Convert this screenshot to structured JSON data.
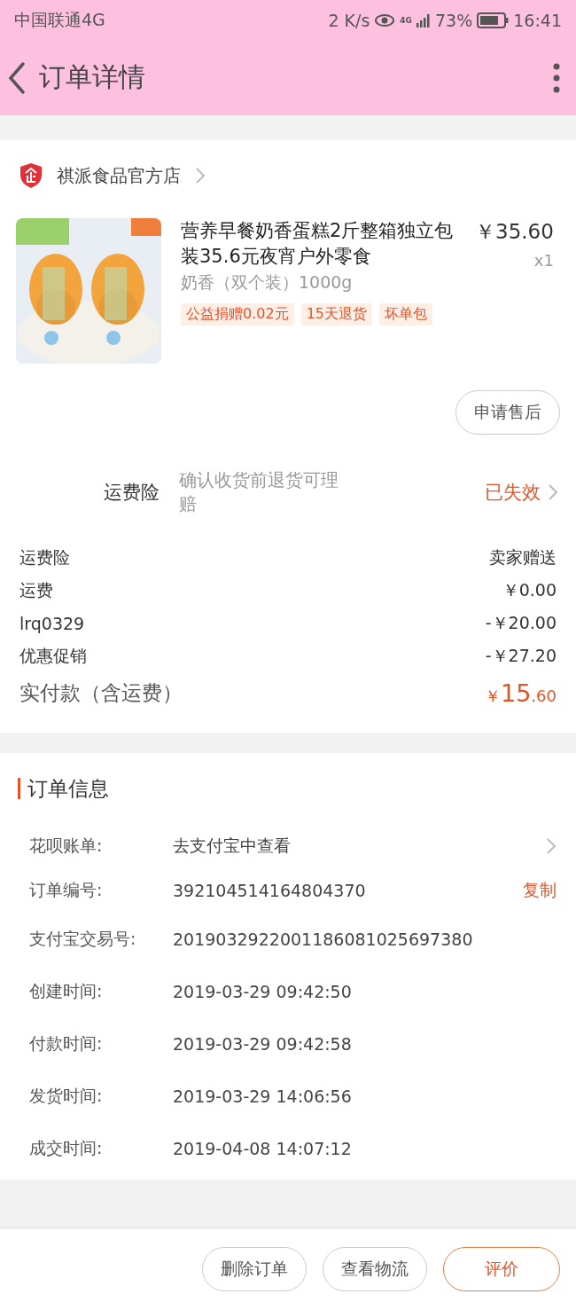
{
  "status_bar": {
    "carrier": "中国联通4G",
    "speed": "2 K/s",
    "network": "4G",
    "battery": "73%",
    "time": "16:41"
  },
  "header": {
    "title": "订单详情"
  },
  "shop": {
    "name": "祺派食品官方店"
  },
  "item": {
    "kind": "picture",
    "title": "营养早餐奶香蛋糕2斤整箱独立包装35.6元夜宵户外零食",
    "price": "￥35.60",
    "quantity": "x1",
    "sku": "奶香（双个装）1000g",
    "tags": [
      "公益捐赠0.02元",
      "15天退货",
      "坏单包"
    ],
    "after_sale": "申请售后"
  },
  "insurance": {
    "label": "运费险",
    "desc": "确认收货前退货可理赔",
    "status": "已失效"
  },
  "costs": [
    {
      "label": "运费险",
      "value": "卖家赠送"
    },
    {
      "label": "运费",
      "value": "￥0.00"
    },
    {
      "label": "lrq0329",
      "value": "-￥20.00"
    },
    {
      "label": "优惠促销",
      "value": "-￥27.20"
    }
  ],
  "total": {
    "label": "实付款（含运费）",
    "currency": "￥",
    "integer": "15",
    "decimal": ".60"
  },
  "order_info": {
    "title": "订单信息",
    "rows": [
      {
        "kind": "link",
        "label": "花呗账单:",
        "value": "去支付宝中查看"
      },
      {
        "kind": "copy",
        "label": "订单编号:",
        "value": "392104514164804370",
        "action": "复制"
      },
      {
        "kind": "plain",
        "label": "支付宝交易号:",
        "value": "2019032922001186081025697380"
      },
      {
        "kind": "plain",
        "label": "创建时间:",
        "value": "2019-03-29 09:42:50"
      },
      {
        "kind": "plain",
        "label": "付款时间:",
        "value": "2019-03-29 09:42:58"
      },
      {
        "kind": "plain",
        "label": "发货时间:",
        "value": "2019-03-29 14:06:56"
      },
      {
        "kind": "plain",
        "label": "成交时间:",
        "value": "2019-04-08 14:07:12"
      }
    ]
  },
  "actions": [
    {
      "label": "删除订单",
      "primary": false
    },
    {
      "label": "查看物流",
      "primary": false
    },
    {
      "label": "评价",
      "primary": true
    }
  ]
}
